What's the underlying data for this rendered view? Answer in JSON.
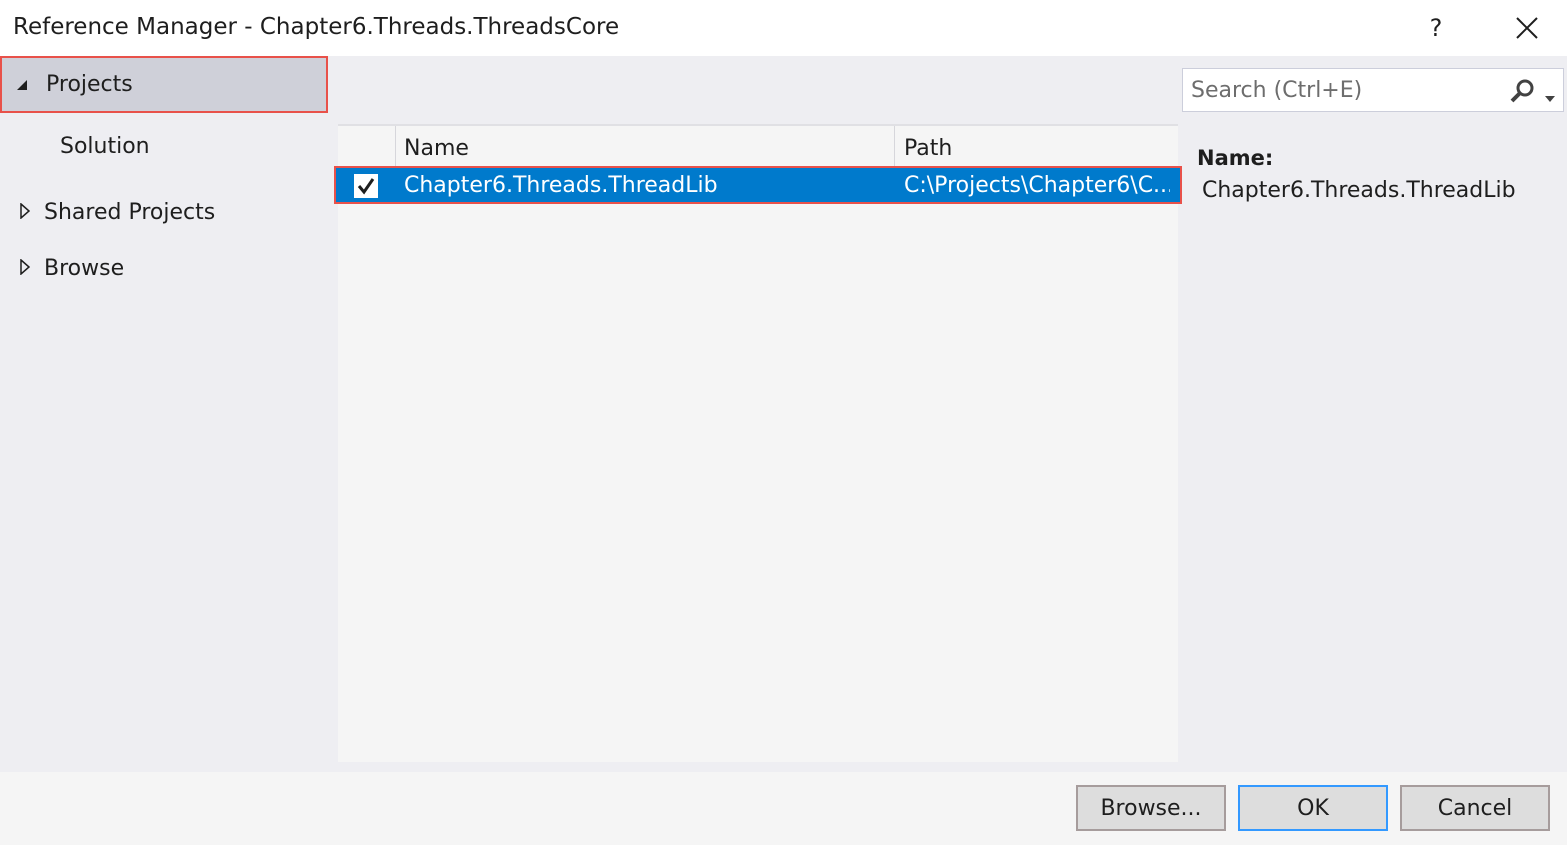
{
  "window": {
    "title": "Reference Manager - Chapter6.Threads.ThreadsCore",
    "help_glyph": "?",
    "close_icon": "close-icon"
  },
  "nav": {
    "items": [
      {
        "label": "Projects",
        "expanded": true,
        "selected": true
      },
      {
        "label": "Solution",
        "child": true
      },
      {
        "label": "Shared Projects",
        "expanded": false
      },
      {
        "label": "Browse",
        "expanded": false
      }
    ]
  },
  "list": {
    "columns": [
      "Name",
      "Path"
    ],
    "rows": [
      {
        "checked": true,
        "name": "Chapter6.Threads.ThreadLib",
        "path": "C:\\Projects\\Chapter6\\C..."
      }
    ]
  },
  "search": {
    "placeholder": "Search (Ctrl+E)",
    "value": ""
  },
  "details": {
    "name_label": "Name:",
    "name_value": "Chapter6.Threads.ThreadLib"
  },
  "footer": {
    "browse_label": "Browse...",
    "ok_label": "OK",
    "cancel_label": "Cancel"
  },
  "colors": {
    "selection": "#007acc",
    "highlight_border": "#e8514a",
    "ok_border": "#3399ff"
  }
}
